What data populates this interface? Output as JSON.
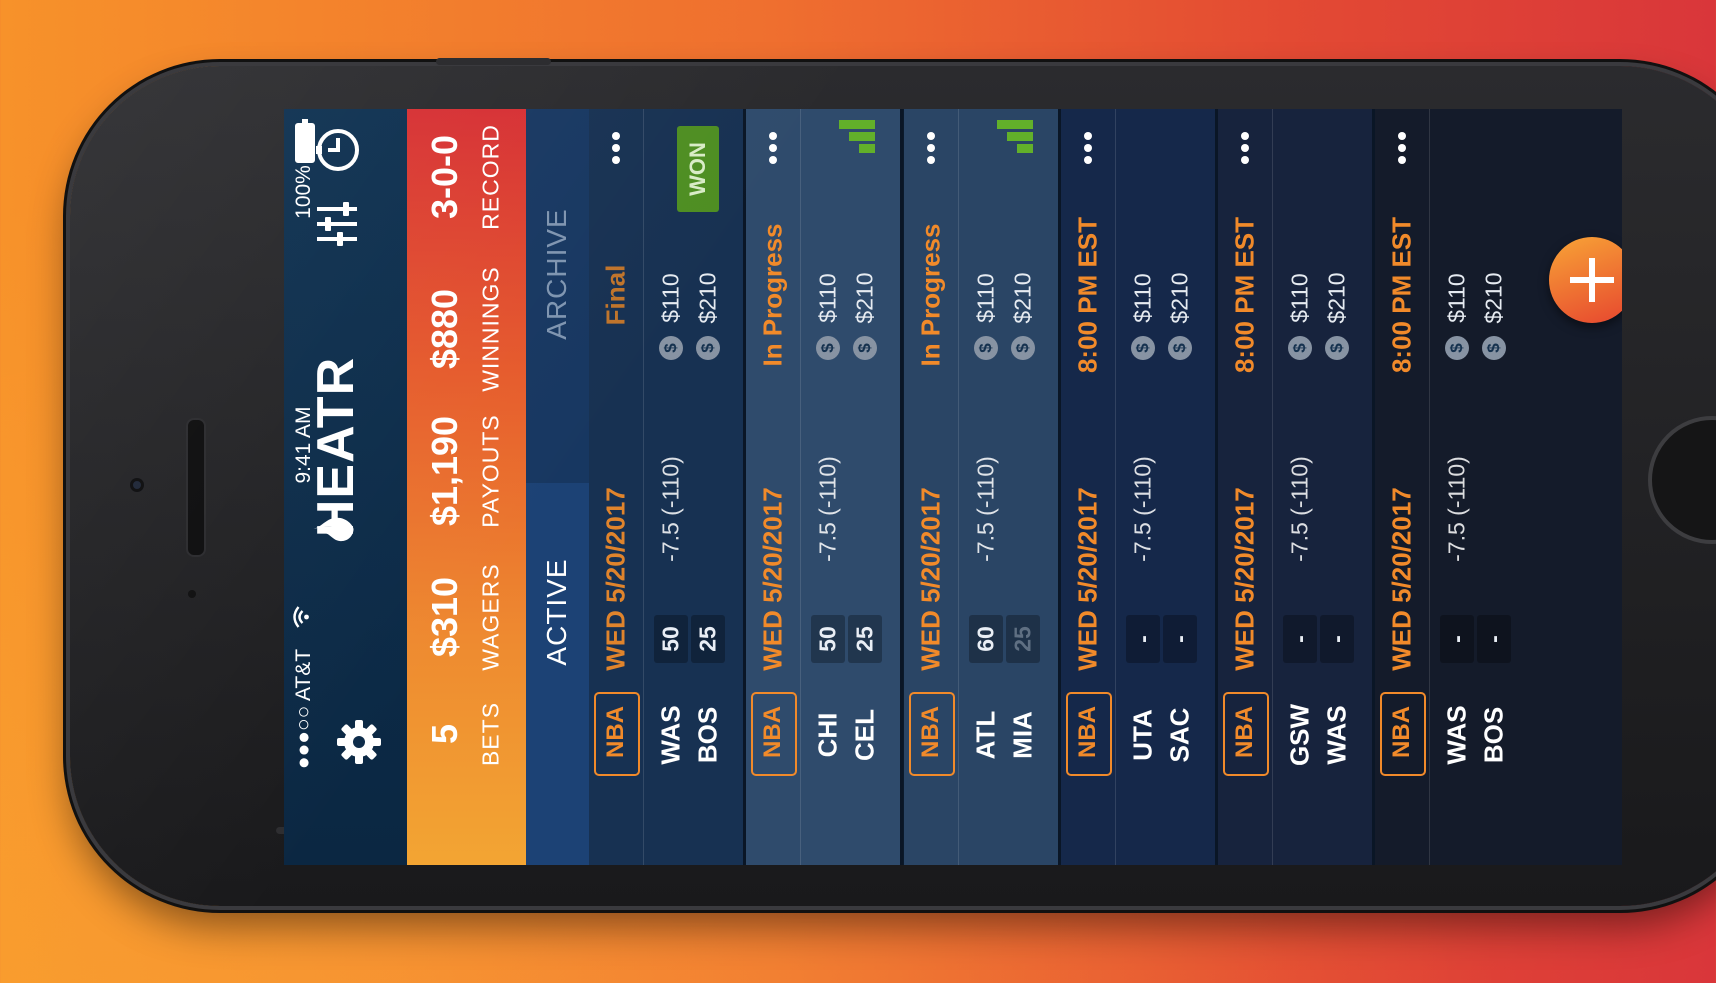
{
  "status_bar": {
    "carrier": "●●●○○ AT&T",
    "time": "9:41 AM",
    "battery": "100%"
  },
  "header": {
    "app_name": "HEATR"
  },
  "icons": {
    "settings": "gear-icon",
    "filters": "sliders-icon",
    "history": "clock-icon",
    "add": "plus-icon",
    "wifi": "wifi-icon"
  },
  "stats": [
    {
      "value": "5",
      "label": "BETS"
    },
    {
      "value": "$310",
      "label": "WAGERS"
    },
    {
      "value": "$1,190",
      "label": "PAYOUTS"
    },
    {
      "value": "$880",
      "label": "WINNINGS"
    },
    {
      "value": "3-0-0",
      "label": "RECORD"
    }
  ],
  "tabs": {
    "active": "ACTIVE",
    "archive": "ARCHIVE",
    "selected": "ACTIVE"
  },
  "colors": {
    "accent": "#f18a2a",
    "won": "#4e8e22",
    "signal": "#62b02a"
  },
  "bets": [
    {
      "league": "NBA",
      "date": "WED 5/20/2017",
      "status": "Final",
      "team1": "WAS",
      "team2": "BOS",
      "score1": "50",
      "score2": "25",
      "line": "-7.5 (-110)",
      "wager": "$110",
      "payout": "$210",
      "badge": "WON"
    },
    {
      "league": "NBA",
      "date": "WED 5/20/2017",
      "status": "In Progress",
      "team1": "CHI",
      "team2": "CEL",
      "score1": "50",
      "score2": "25",
      "line": "-7.5 (-110)",
      "wager": "$110",
      "payout": "$210"
    },
    {
      "league": "NBA",
      "date": "WED 5/20/2017",
      "status": "In Progress",
      "team1": "ATL",
      "team2": "MIA",
      "score1": "60",
      "score2": "25",
      "line": "-7.5 (-110)",
      "wager": "$110",
      "payout": "$210"
    },
    {
      "league": "NBA",
      "date": "WED 5/20/2017",
      "status": "8:00 PM EST",
      "team1": "UTA",
      "team2": "SAC",
      "score1": "-",
      "score2": "-",
      "line": "-7.5 (-110)",
      "wager": "$110",
      "payout": "$210"
    },
    {
      "league": "NBA",
      "date": "WED 5/20/2017",
      "status": "8:00 PM EST",
      "team1": "GSW",
      "team2": "WAS",
      "score1": "-",
      "score2": "-",
      "line": "-7.5 (-110)",
      "wager": "$110",
      "payout": "$210"
    },
    {
      "league": "NBA",
      "date": "WED 5/20/2017",
      "status": "8:00 PM EST",
      "team1": "WAS",
      "team2": "BOS",
      "score1": "-",
      "score2": "-",
      "line": "-7.5 (-110)",
      "wager": "$110",
      "payout": "$210"
    }
  ]
}
